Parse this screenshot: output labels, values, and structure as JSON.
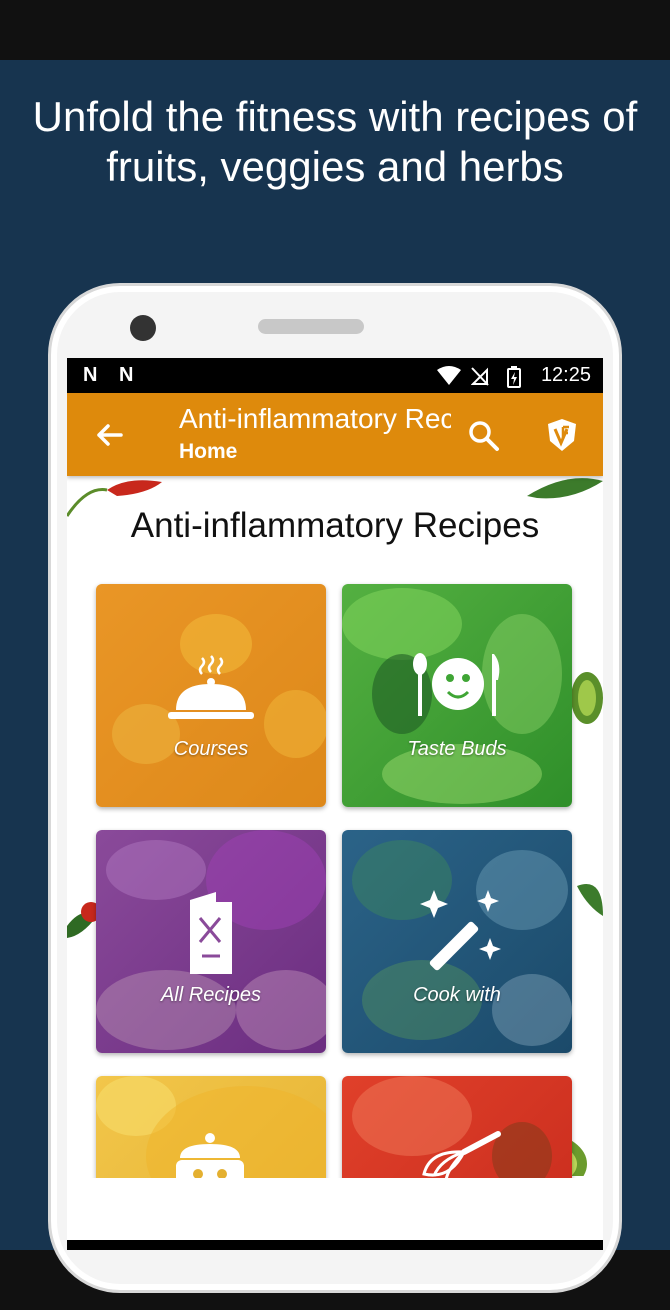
{
  "headline": "Unfold the fitness with recipes of fruits, veggies and herbs",
  "status": {
    "time": "12:25",
    "notif_icons": [
      "N",
      "N"
    ]
  },
  "appbar": {
    "title": "Anti-inflammatory Recipes",
    "subtitle": "Home"
  },
  "page_title": "Anti-inflammatory Recipes",
  "tiles": [
    {
      "label": "Courses",
      "icon": "cloche-icon"
    },
    {
      "label": "Taste Buds",
      "icon": "smiley-utensils-icon"
    },
    {
      "label": "All Recipes",
      "icon": "menu-card-icon"
    },
    {
      "label": "Cook with",
      "icon": "magic-wand-icon"
    },
    {
      "label": "",
      "icon": "cooking-pot-icon"
    },
    {
      "label": "",
      "icon": "whisk-icon"
    }
  ],
  "colors": {
    "background": "#17344f",
    "appbar": "#de8a0c",
    "tile_orange": "#e8962c",
    "tile_green": "#3fa535",
    "tile_purple": "#7b3a8c",
    "tile_blue": "#1e4f73"
  }
}
